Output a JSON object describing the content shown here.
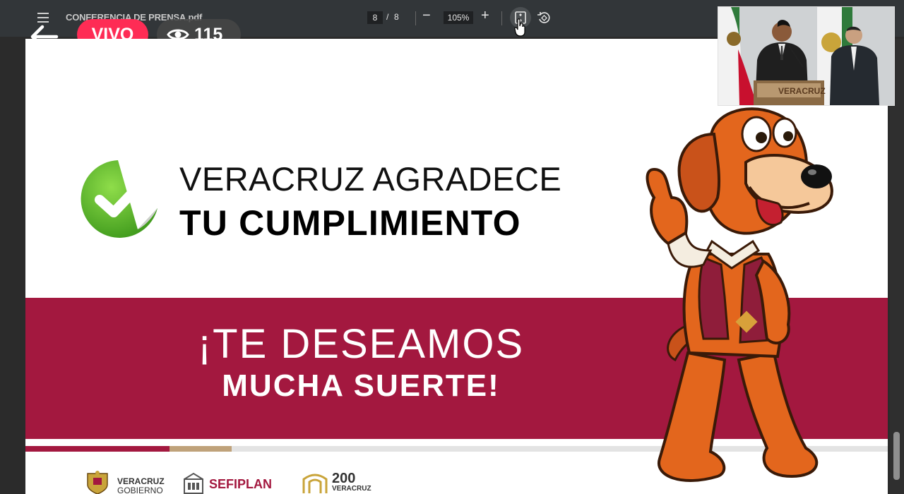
{
  "viewer": {
    "doc_title": "CONFERENCIA DE PRENSA.pdf",
    "current_page": "8",
    "page_separator": "/",
    "total_pages": "8",
    "zoom_out_label": "−",
    "zoom_level": "105%",
    "zoom_in_label": "+"
  },
  "live": {
    "badge_label": "VIVO",
    "viewer_count": "115"
  },
  "slide": {
    "headline_line1": "VERACRUZ AGRADECE",
    "headline_line2": "TU CUMPLIMIENTO",
    "band_line1": "¡TE DESEAMOS",
    "band_line2": "MUCHA SUERTE!",
    "footer_logos": {
      "veracruz_a": "VERACRUZ",
      "veracruz_b": "GOBIERNO",
      "sefiplan": "SEFIPLAN",
      "bicentenario_num": "200",
      "bicentenario_text": "VERACRUZ"
    },
    "stripe_colors": [
      "#a3183f",
      "#bfa27a",
      "#e3e3e3"
    ]
  },
  "camera": {
    "podium_label": "VERACRUZ"
  },
  "colors": {
    "live_red": "#fe2c55",
    "maroon": "#a3183f",
    "check_green": "#6cc23a",
    "dog_orange": "#e3661d"
  }
}
